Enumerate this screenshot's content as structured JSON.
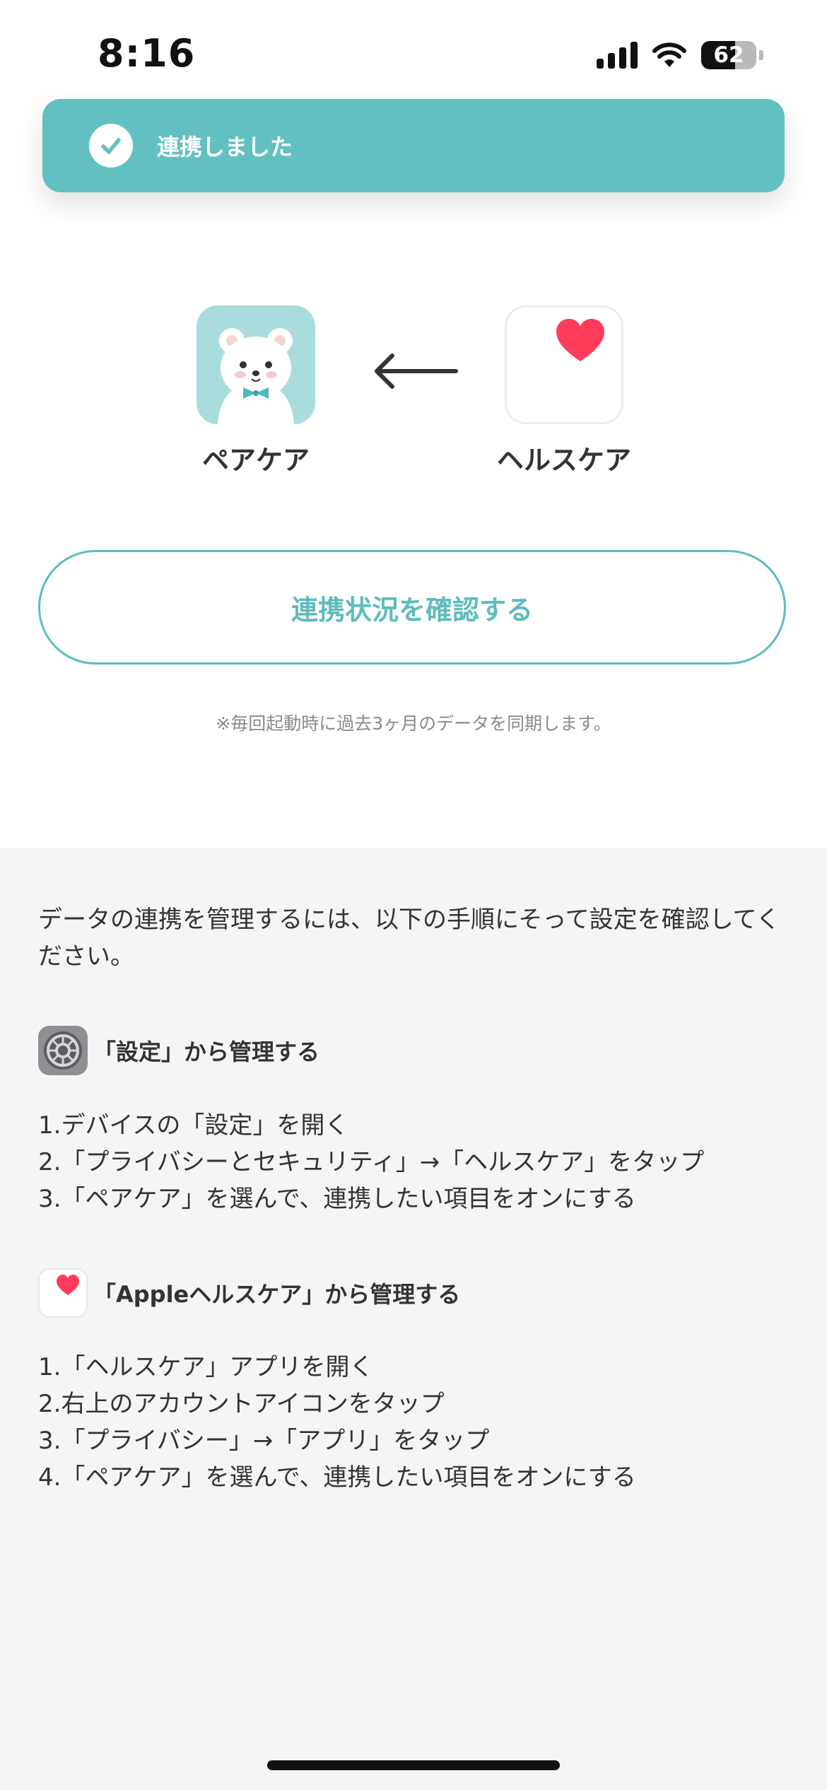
{
  "status_bar": {
    "time": "8:16",
    "battery": "62",
    "battery_level": 0.62
  },
  "toast": {
    "message": "連携しました"
  },
  "apps": {
    "source": {
      "name": "ペアケア"
    },
    "target": {
      "name": "ヘルスケア"
    }
  },
  "check_button": {
    "label": "連携状況を確認する"
  },
  "sync_note": "※毎回起動時に過去3ヶ月のデータを同期します。",
  "instructions": {
    "intro": "データの連携を管理するには、以下の手順にそって設定を確認してください。",
    "settings_section": {
      "title": "「設定」から管理する",
      "steps": [
        "1.デバイスの「設定」を開く",
        "2.「プライバシーとセキュリティ」→「ヘルスケア」をタップ",
        "3.「ペアケア」を選んで、連携したい項目をオンにする"
      ]
    },
    "health_section": {
      "title": "「Appleヘルスケア」から管理する",
      "steps": [
        "1.「ヘルスケア」アプリを開く",
        "2.右上のアカウントアイコンをタップ",
        "3.「プライバシー」→「アプリ」をタップ",
        "4.「ペアケア」を選んで、連携したい項目をオンにする"
      ]
    }
  },
  "colors": {
    "accent": "#5fbcbc",
    "toast": "#63c0c0",
    "heart": "#ff3b5c",
    "bear_bg": "#a9dcdc"
  },
  "icons": [
    "check-icon",
    "bear-app-icon",
    "arrow-left-icon",
    "heart-app-icon",
    "settings-gear-icon",
    "health-heart-icon"
  ]
}
